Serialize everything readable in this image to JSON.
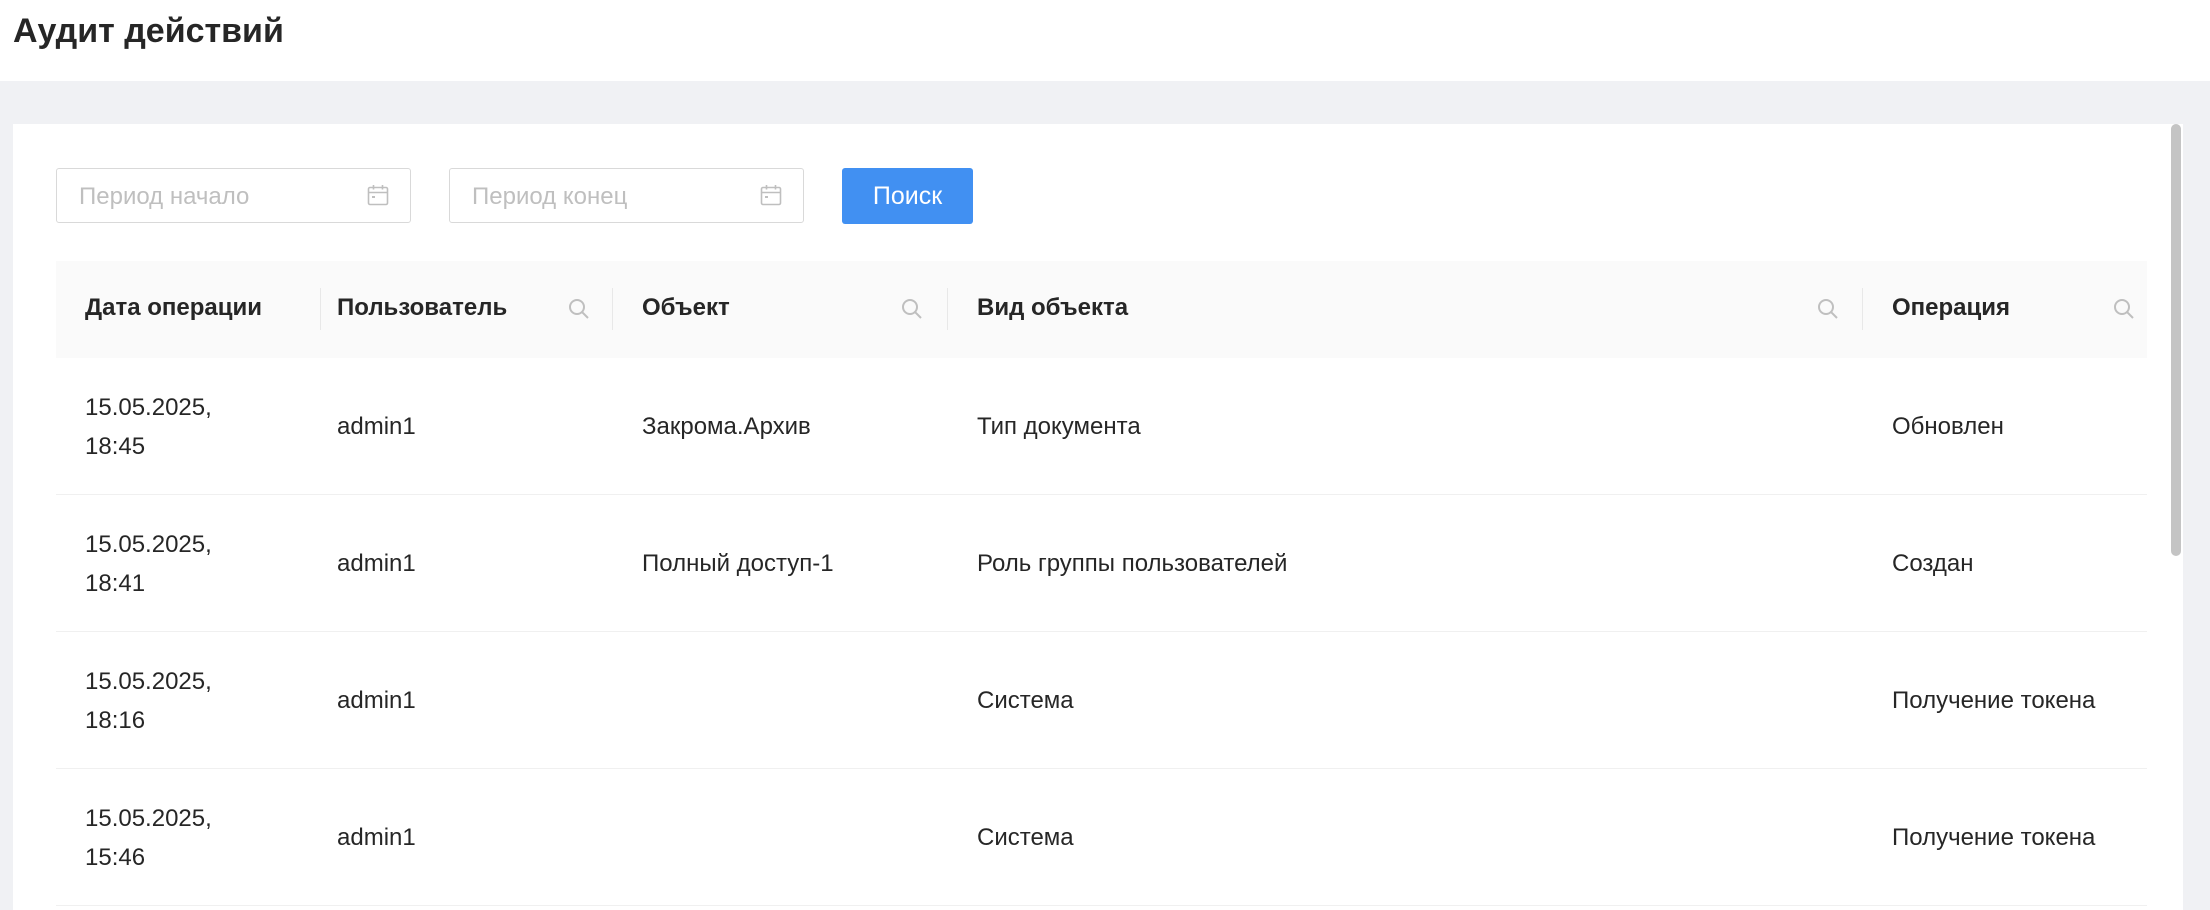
{
  "page": {
    "title": "Аудит действий"
  },
  "filters": {
    "period_start_placeholder": "Период начало",
    "period_end_placeholder": "Период конец",
    "search_button_label": "Поиск"
  },
  "table": {
    "columns": [
      {
        "label": "Дата операции",
        "searchable": false
      },
      {
        "label": "Пользователь",
        "searchable": true
      },
      {
        "label": "Объект",
        "searchable": true
      },
      {
        "label": "Вид объекта",
        "searchable": true
      },
      {
        "label": "Операция",
        "searchable": true
      }
    ],
    "rows": [
      {
        "date": "15.05.2025, 18:45",
        "user": "admin1",
        "object": "Закрома.Архив",
        "object_type": "Тип документа",
        "operation": "Обновлен"
      },
      {
        "date": "15.05.2025, 18:41",
        "user": "admin1",
        "object": "Полный доступ-1",
        "object_type": "Роль группы пользователей",
        "operation": "Создан"
      },
      {
        "date": "15.05.2025, 18:16",
        "user": "admin1",
        "object": "",
        "object_type": "Система",
        "operation": "Получение токена"
      },
      {
        "date": "15.05.2025, 15:46",
        "user": "admin1",
        "object": "",
        "object_type": "Система",
        "operation": "Получение токена"
      }
    ]
  },
  "colors": {
    "accent": "#4190f2",
    "header_bg": "#fafafa",
    "page_bg": "#f0f1f4",
    "placeholder": "#bfbfbf"
  },
  "icons": {
    "date_picker": "calendar-icon",
    "column_filter": "search-icon"
  }
}
